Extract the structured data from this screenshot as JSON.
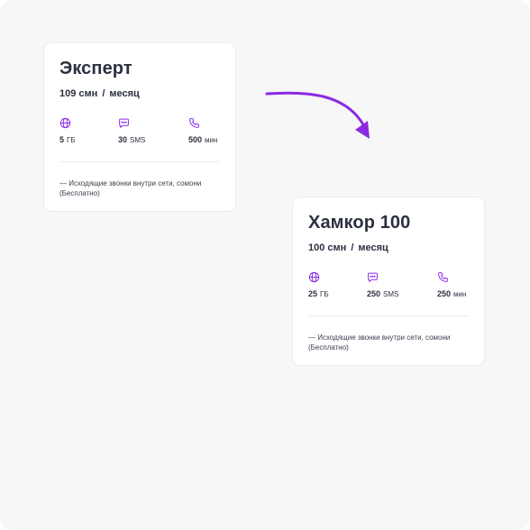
{
  "colors": {
    "accent": "#8a2be2",
    "text": "#2c3140",
    "background": "#f7f7f8",
    "card": "#ffffff"
  },
  "arrow_icon": "curved-arrow-right-down",
  "plans": [
    {
      "title": "Эксперт",
      "price": "109 смн",
      "slash": "/",
      "period": "месяц",
      "features": [
        {
          "icon": "globe-icon",
          "value": "5",
          "unit": "ГБ"
        },
        {
          "icon": "sms-icon",
          "value": "30",
          "unit": "SMS"
        },
        {
          "icon": "phone-icon",
          "value": "500",
          "unit": "мин"
        }
      ],
      "note": "— Исходящие звонки внутри сети, сомони (Бесплатно)"
    },
    {
      "title": "Хамкор 100",
      "price": "100 смн",
      "slash": "/",
      "period": "месяц",
      "features": [
        {
          "icon": "globe-icon",
          "value": "25",
          "unit": "ГБ"
        },
        {
          "icon": "sms-icon",
          "value": "250",
          "unit": "SMS"
        },
        {
          "icon": "phone-icon",
          "value": "250",
          "unit": "мин"
        }
      ],
      "note": "— Исходящие звонки внутри сети, сомони (Бесплатно)"
    }
  ]
}
